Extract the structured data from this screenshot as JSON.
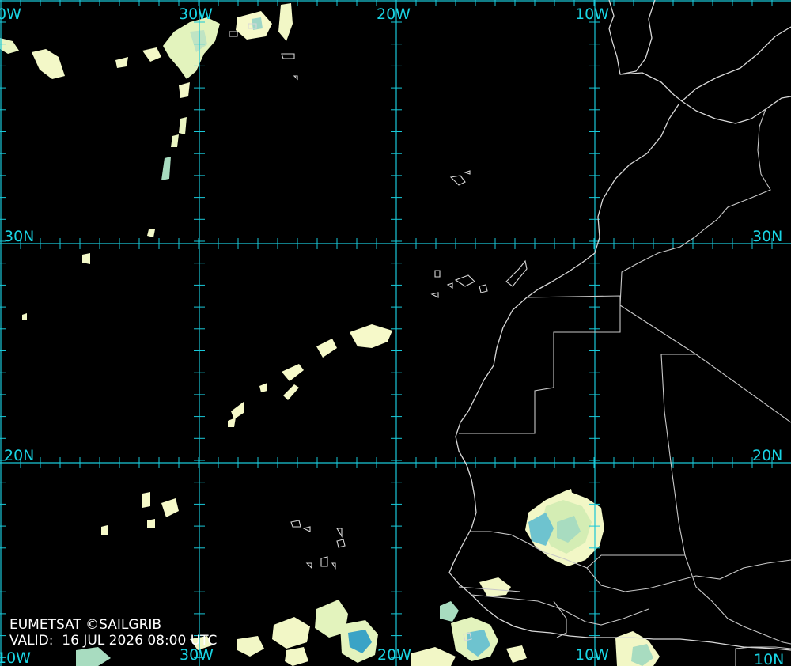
{
  "map": {
    "background": "#000000",
    "grid_color": "#19c8d8",
    "coast_color": "#d8d8d8",
    "cloud_palette": [
      "#fbfccb",
      "#d9f0b0",
      "#a8dcc0",
      "#6ec3cf",
      "#3aa3c6"
    ],
    "longitude_labels": [
      "0W",
      "30W",
      "20W",
      "10W"
    ],
    "longitude_labels_bottom": [
      "10W",
      "30W",
      "20W",
      "10W"
    ],
    "latitude_labels": [
      "30N",
      "20N"
    ],
    "latitude_labels_bottom": [
      "10N"
    ]
  },
  "caption": {
    "source": "EUMETSAT ©SAILGRIB",
    "valid": "VALID:  16 JUL 2026 08:00 UTC"
  }
}
